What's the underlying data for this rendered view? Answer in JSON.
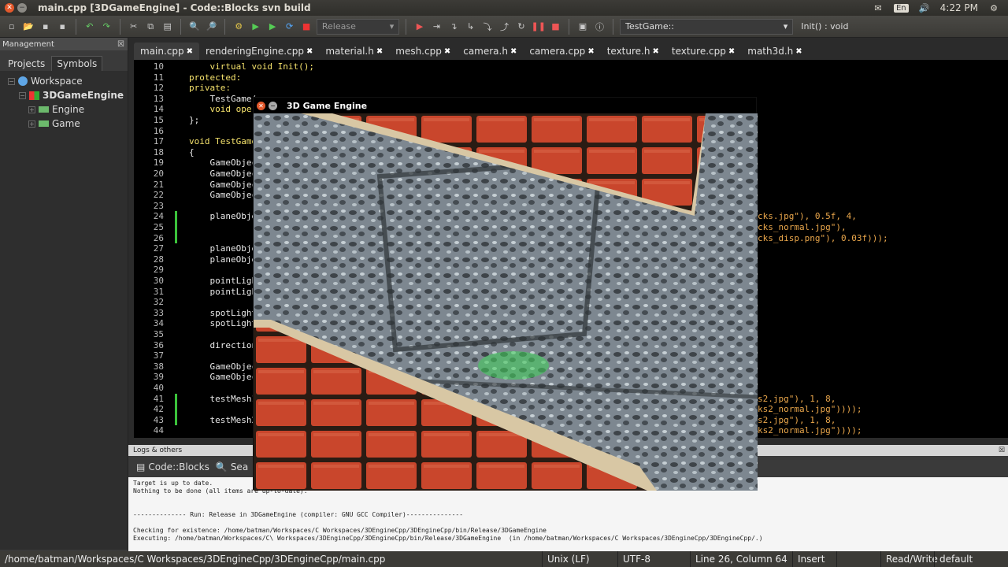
{
  "titlebar": {
    "title": "main.cpp [3DGameEngine] - Code::Blocks svn build",
    "time": "4:22 PM",
    "kbd": "En"
  },
  "toolbar": {
    "build_target": "Release",
    "scope": "TestGame::",
    "function": "Init() : void"
  },
  "management": {
    "header": "Management",
    "tabs": [
      "Projects",
      "Symbols"
    ],
    "tree": {
      "workspace": "Workspace",
      "project": "3DGameEngine",
      "folders": [
        "Engine",
        "Game"
      ]
    }
  },
  "editor_tabs": [
    "main.cpp",
    "renderingEngine.cpp",
    "material.h",
    "mesh.cpp",
    "camera.h",
    "camera.cpp",
    "texture.h",
    "texture.cpp",
    "math3d.h"
  ],
  "editor": {
    "line_numbers": [
      "10",
      "11",
      "12",
      "13",
      "14",
      "15",
      "16",
      "17",
      "18",
      "19",
      "20",
      "21",
      "22",
      "23",
      "24",
      "25",
      "26",
      "27",
      "28",
      "29",
      "30",
      "31",
      "32",
      "33",
      "34",
      "35",
      "36",
      "37",
      "38",
      "39",
      "40",
      "41",
      "42",
      "43",
      "44"
    ],
    "lines": [
      "    virtual void Init();",
      "protected:",
      "private:",
      "    TestGame(",
      "    void oper",
      "};",
      "",
      "void TestGame",
      "{",
      "    GameObjec",
      "    GameObjec",
      "    GameObjec",
      "    GameObjec",
      "",
      "    planeObje",
      "",
      "",
      "    planeObje",
      "    planeObje",
      "",
      "    pointLigh",
      "    pointLigh",
      "",
      "    spotLight",
      "    spotLight",
      "",
      "    direction",
      "",
      "    GameObjec",
      "    GameObjec",
      "",
      "    testMesh1",
      "",
      "    testMesh2",
      ""
    ],
    "right_fragments": [
      {
        "line": 14,
        "text": "cks.jpg\"), 0.5f, 4,"
      },
      {
        "line": 15,
        "text": "cks_normal.jpg\"),"
      },
      {
        "line": 16,
        "text": "cks_disp.png\"), 0.03f)));"
      },
      {
        "line": 31,
        "text": "s2.jpg\"), 1, 8,"
      },
      {
        "line": 32,
        "text": "ks2_normal.jpg\"))));"
      },
      {
        "line": 33,
        "text": "s2.jpg\"), 1, 8,"
      },
      {
        "line": 34,
        "text": "ks2_normal.jpg\"))));"
      }
    ]
  },
  "game_window": {
    "title": "3D Game Engine"
  },
  "logs": {
    "header": "Logs & others",
    "tabs": [
      "Code::Blocks",
      "Sea"
    ],
    "lines": [
      "Target is up to date.",
      "Nothing to be done (all items are up-to-date).",
      "",
      "",
      "-------------- Run: Release in 3DGameEngine (compiler: GNU GCC Compiler)---------------",
      "",
      "Checking for existence: /home/batman/Workspaces/C Workspaces/3DEngineCpp/3DEngineCpp/bin/Release/3DGameEngine",
      "Executing: /home/batman/Workspaces/C\\ Workspaces/3DEngineCpp/3DEngineCpp/bin/Release/3DGameEngine  (in /home/batman/Workspaces/C Workspaces/3DEngineCpp/3DEngineCpp/.)"
    ]
  },
  "statusbar": {
    "path": "/home/batman/Workspaces/C Workspaces/3DEngineCpp/3DEngineCpp/main.cpp",
    "eol": "Unix (LF)",
    "encoding": "UTF-8",
    "position": "Line 26, Column 64",
    "mode": "Insert",
    "access": "Read/Write",
    "profile": "default"
  },
  "colors": {
    "keyword": "#f5e26c",
    "string": "#e9a64b",
    "change_marker": "#3bc33b",
    "brick": "#c9462c",
    "stone": "#7d8790"
  }
}
